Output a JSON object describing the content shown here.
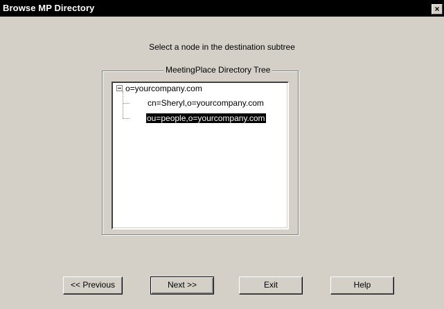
{
  "window": {
    "title": "Browse MP Directory",
    "close_label": "×"
  },
  "prompt": "Select a node in the destination subtree",
  "group": {
    "label": "MeetingPlace Directory Tree"
  },
  "tree": {
    "root": {
      "label": "o=yourcompany.com",
      "expanded": true
    },
    "children": [
      {
        "label": "cn=Sheryl,o=yourcompany.com",
        "selected": false
      },
      {
        "label": "ou=people,o=yourcompany.com",
        "selected": true
      }
    ]
  },
  "buttons": {
    "previous": "<< Previous",
    "next": "Next >>",
    "exit": "Exit",
    "help": "Help"
  }
}
